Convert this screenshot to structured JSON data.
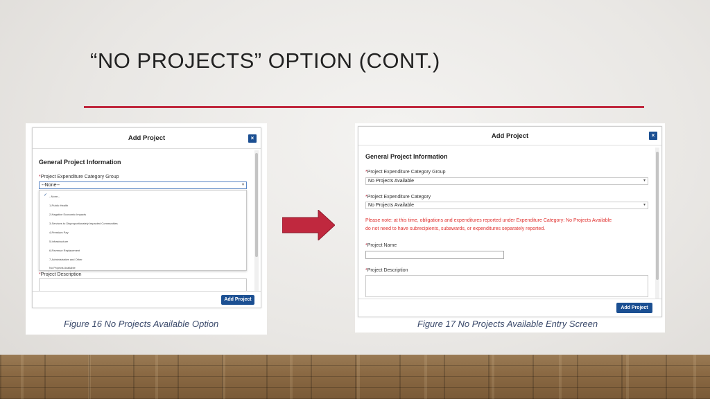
{
  "slide": {
    "title": "“NO PROJECTS” OPTION (CONT.)"
  },
  "colors": {
    "accent_rule": "#c0283e",
    "button_blue": "#1b4f92",
    "notice_red": "#e0312f",
    "arrow_red": "#c0283e"
  },
  "figure16": {
    "caption": "Figure 16 No Projects Available Option",
    "modal_title": "Add Project",
    "close_icon": "×",
    "section_title": "General Project Information",
    "category_group_label": "Project Expenditure Category Group",
    "category_group_value": "--None--",
    "dropdown_options": [
      "--None--",
      "1-Public Health",
      "2-Negative Economic Impacts",
      "3-Services to Disproportionately Impacted Communities",
      "4-Premium Pay",
      "5-Infrastructure",
      "6-Revenue Replacement",
      "7-Administrative and Other",
      "No Projects Available"
    ],
    "selected_option_index": 0,
    "description_label": "Project Description",
    "add_button": "Add Project"
  },
  "figure17": {
    "caption": "Figure 17 No Projects Available Entry Screen",
    "modal_title": "Add Project",
    "close_icon": "×",
    "section_title": "General Project Information",
    "category_group_label": "Project Expenditure Category Group",
    "category_group_value": "No Projects Available",
    "category_label": "Project Expenditure Category",
    "category_value": "No Projects Available",
    "notice_line1": "Please note: at this time, obligations and expenditures reported under Expenditure Category: No Projects Available",
    "notice_line2": "do not need to have subrecipients, subawards, or expenditures separately reported.",
    "project_name_label": "Project Name",
    "project_name_value": "",
    "description_label": "Project Description",
    "add_button": "Add Project"
  },
  "required_marker": "*",
  "caret_icon": "▾",
  "check_icon": "✓"
}
